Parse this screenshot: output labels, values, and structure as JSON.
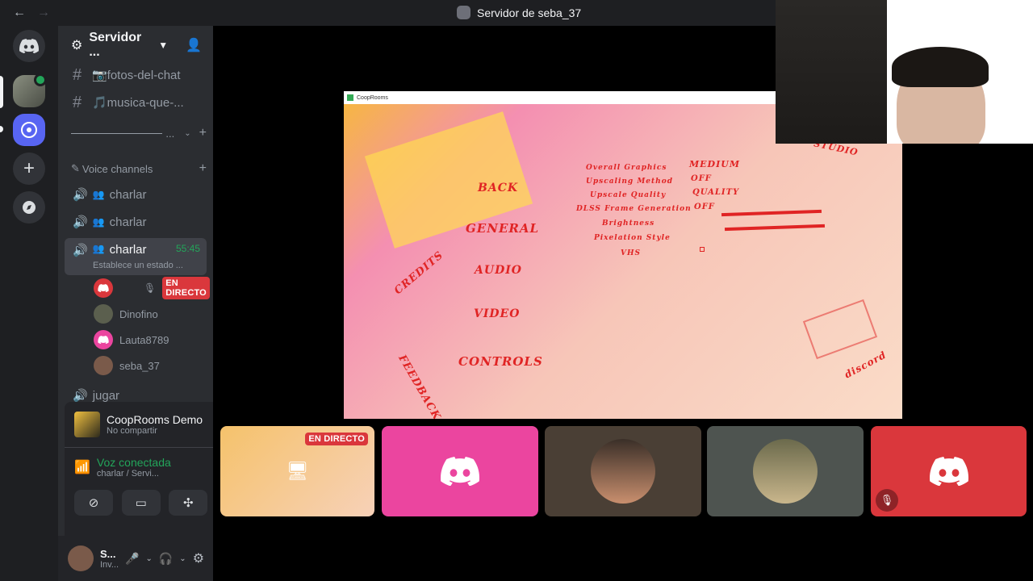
{
  "window": {
    "back_icon": "←",
    "forward_icon": "→",
    "title": "Servidor de seba_37"
  },
  "server": {
    "name": "Servidor ...",
    "channels": [
      {
        "label": "📷fotos-del-chat"
      },
      {
        "label": "🎵musica-que-..."
      }
    ],
    "divider_label": "...",
    "voice_category": "Voice channels",
    "voice_channels": [
      {
        "label": "charlar"
      },
      {
        "label": "charlar"
      },
      {
        "label": "charlar",
        "time": "55:45",
        "status": "Establece un estado ..."
      }
    ],
    "voice_users": [
      {
        "name": "",
        "badge": "EN DIRECTO"
      },
      {
        "name": "Dinofino"
      },
      {
        "name": "Lauta8789"
      },
      {
        "name": "seba_37"
      }
    ],
    "cutoff_channel": "jugar"
  },
  "activity": {
    "title": "CoopRooms Demo",
    "subtitle": "No compartir"
  },
  "voice": {
    "status": "Voz conectada",
    "location": "charlar / Servi..."
  },
  "user": {
    "name": "S...",
    "status": "Inv..."
  },
  "game": {
    "window_title": "CoopRooms",
    "menu": [
      "BACK",
      "GENERAL",
      "AUDIO",
      "VIDEO",
      "CONTROLS",
      "CREDITS",
      "FEEDBACK"
    ],
    "settings_labels": [
      "Overall Graphics",
      "Upscaling Method",
      "Upscale Quality",
      "DLSS Frame Generation",
      "Brightness",
      "Pixelation Style",
      "VHS"
    ],
    "settings_values": [
      "MEDIUM",
      "OFF",
      "QUALITY",
      "OFF"
    ],
    "studio_label": "STUDIO",
    "discord_label": "discord"
  },
  "tiles": {
    "live_badge": "EN DIRECTO"
  },
  "colors": {
    "accent": "#23a55a",
    "live": "#da373c",
    "pink": "#eb459f",
    "blurple": "#5865f2"
  }
}
